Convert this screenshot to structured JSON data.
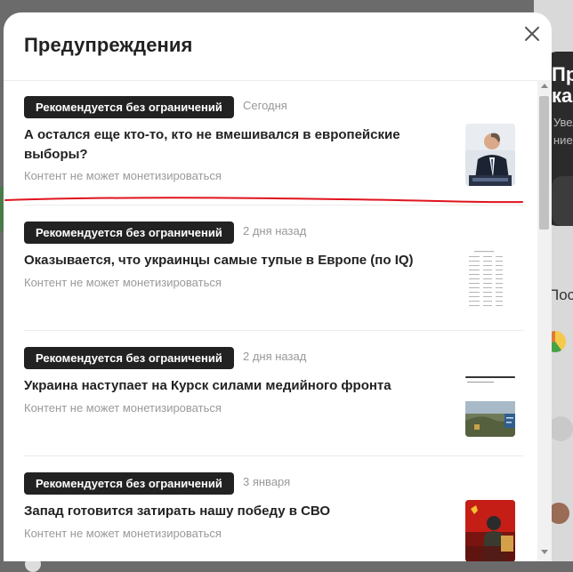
{
  "modal": {
    "title": "Предупреждения",
    "close_icon": "close-icon"
  },
  "notifications": [
    {
      "badge": "Рекомендуется без ограничений",
      "date": "Сегодня",
      "title": "А остался еще кто-то, кто не вмешивался в европейские выборы?",
      "status": "Контент не может монетизироваться",
      "thumbnail": "photo-man-at-podium"
    },
    {
      "badge": "Рекомендуется без ограничений",
      "date": "2 дня назад",
      "title": "Оказывается, что украинцы самые тупые в Европе (по IQ)",
      "status": "Контент не может монетизироваться",
      "thumbnail": "table-document"
    },
    {
      "badge": "Рекомендуется без ограничений",
      "date": "2 дня назад",
      "title": "Украина наступает на Курск силами медийного фронта",
      "status": "Контент не может монетизироваться",
      "thumbnail": "photo-road-sign"
    },
    {
      "badge": "Рекомендуется без ограничений",
      "date": "3 января",
      "title": "Запад готовится затирать нашу победу в СВО",
      "status": "Контент не может монетизироваться",
      "thumbnail": "photo-soldier-red-flag"
    }
  ],
  "colors": {
    "badge_bg": "#222222",
    "annotation_line": "#e0141e"
  }
}
